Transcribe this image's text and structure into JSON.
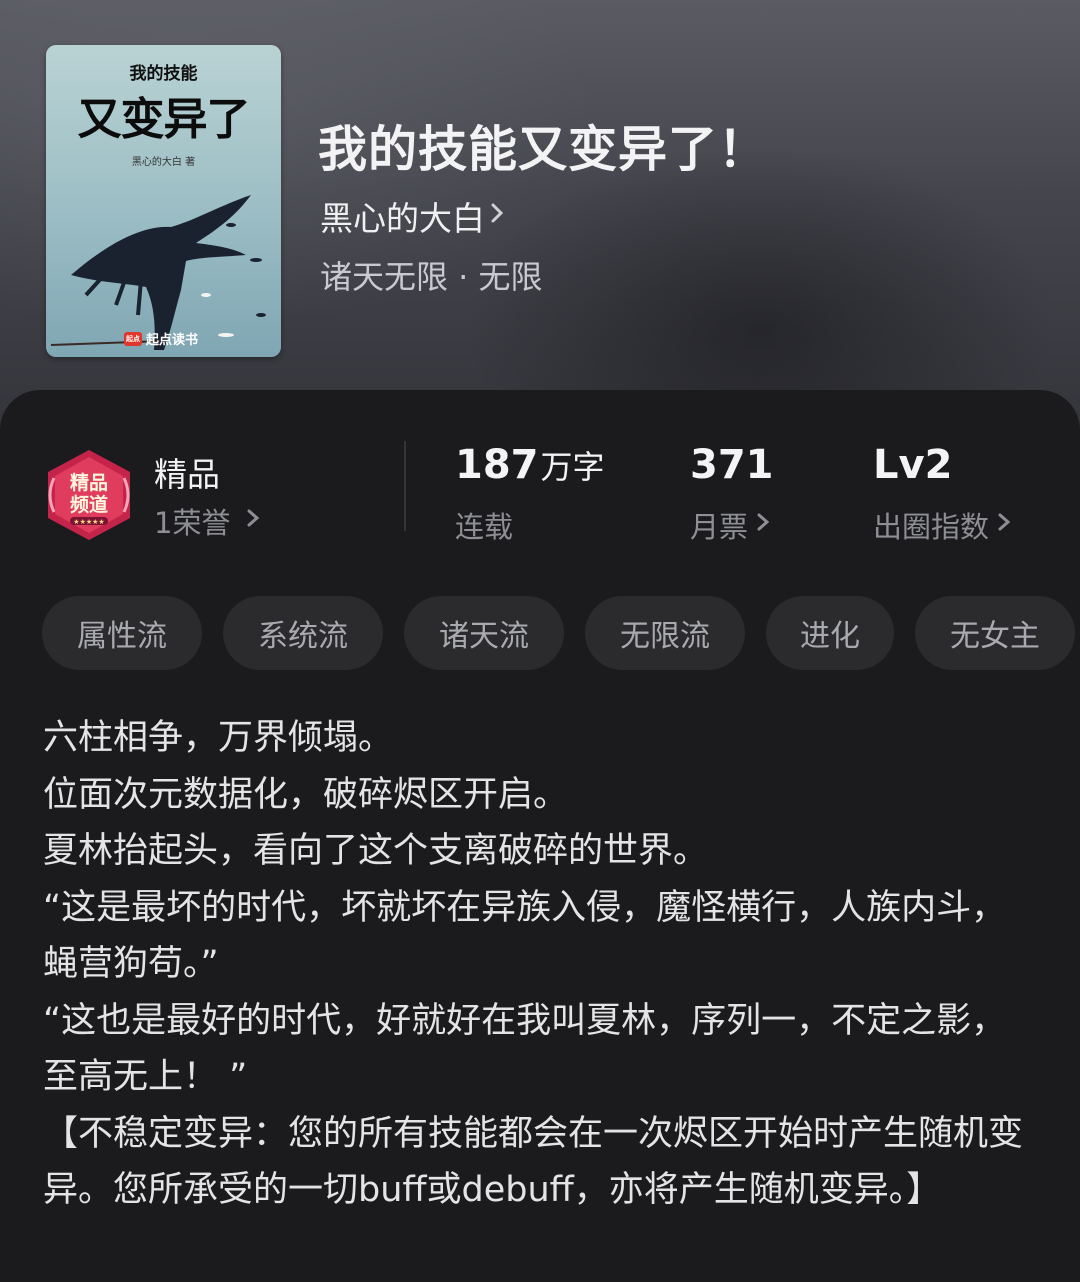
{
  "book": {
    "cover": {
      "small_title": "我的技能",
      "big_title": "又变异了",
      "author": "黑心的大白 著",
      "publisher": "起点读书",
      "publisher_mark": "起点"
    },
    "title": "我的技能又变异了！",
    "author": "黑心的大白",
    "genre": "诸天无限 · 无限"
  },
  "stats": {
    "badge": {
      "title": "精品",
      "sub": "1荣誉",
      "badge_text_1": "精品",
      "badge_text_2": "频道"
    },
    "words": {
      "number": "187",
      "unit": "万字",
      "label": "连载"
    },
    "votes": {
      "number": "371",
      "label": "月票"
    },
    "level": {
      "number": "Lv2",
      "label": "出圈指数"
    }
  },
  "tags": [
    "属性流",
    "系统流",
    "诸天流",
    "无限流",
    "进化",
    "无女主"
  ],
  "synopsis": [
    "六柱相争，万界倾塌。",
    "位面次元数据化，破碎烬区开启。",
    "夏林抬起头，看向了这个支离破碎的世界。",
    "“这是最坏的时代，坏就坏在异族入侵，魔怪横行，人族内斗，蝇营狗苟。”",
    "“这也是最好的时代，好就好在我叫夏林，序列一，不定之影，至高无上！ ”",
    "【不稳定变异：您的所有技能都会在一次烬区开始时产生随机变异。您所承受的一切buff或debuff，亦将产生随机变异。】"
  ],
  "icons": {
    "chevron": "chevron-right-icon",
    "badge": "premium-badge-icon"
  },
  "colors": {
    "card_bg": "#1b1b1d",
    "tag_bg": "#2b2b2e",
    "badge_red": "#c4244a"
  }
}
